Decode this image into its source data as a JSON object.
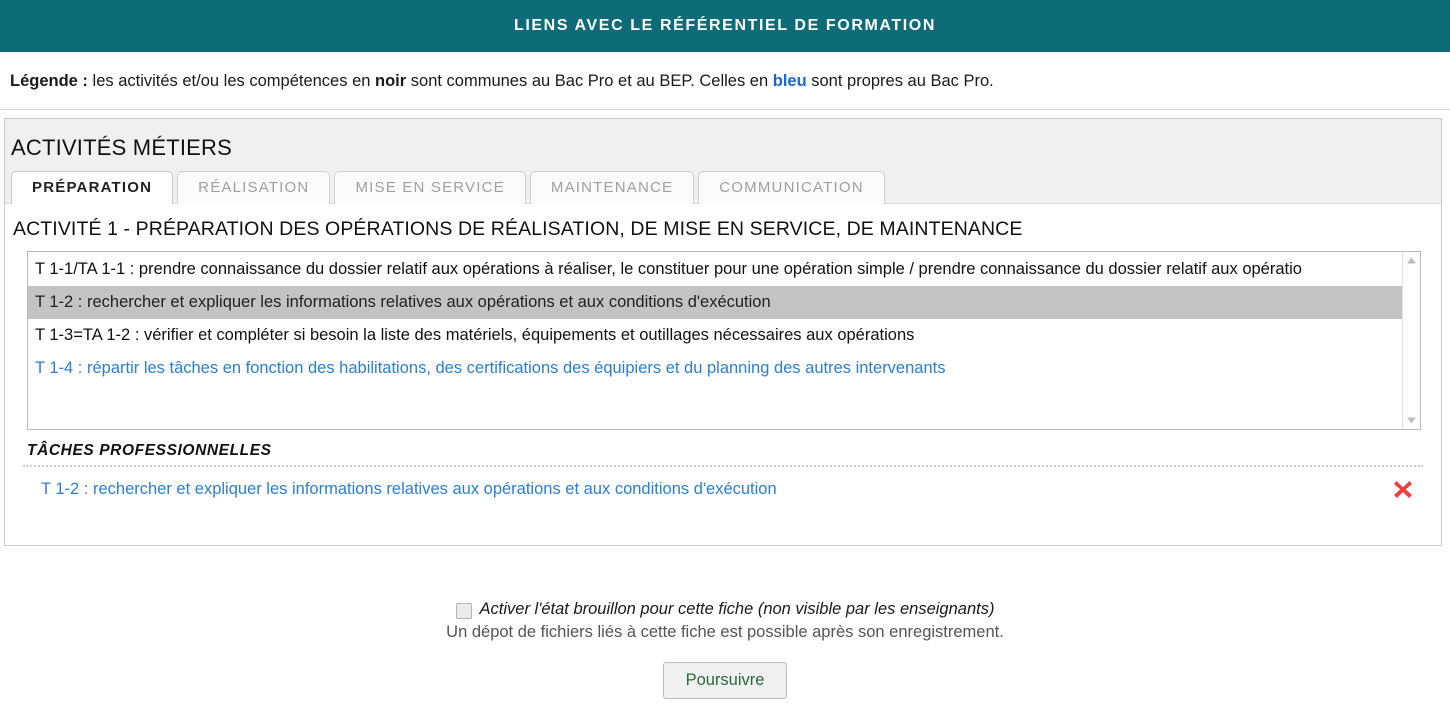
{
  "header": {
    "title": "LIENS AVEC LE RÉFÉRENTIEL DE FORMATION",
    "bg_color": "#0d6c77",
    "text_color": "#ffffff"
  },
  "legend": {
    "label": "Légende :",
    "part1": " les activités et/ou les compétences en ",
    "bold_word": "noir",
    "part2": " sont communes au Bac Pro et au BEP. Celles en ",
    "blue_word": "bleu",
    "part3": " sont propres au Bac Pro.",
    "blue_color": "#1868d8"
  },
  "section": {
    "title": "ACTIVITÉS MÉTIERS"
  },
  "tabs": [
    {
      "label": "PRÉPARATION",
      "active": true
    },
    {
      "label": "RÉALISATION",
      "active": false
    },
    {
      "label": "MISE EN SERVICE",
      "active": false
    },
    {
      "label": "MAINTENANCE",
      "active": false
    },
    {
      "label": "COMMUNICATION",
      "active": false
    }
  ],
  "activity": {
    "heading": "ACTIVITÉ 1 - PRÉPARATION DES OPÉRATIONS DE RÉALISATION, DE MISE EN SERVICE, DE MAINTENANCE"
  },
  "listbox": {
    "items": [
      {
        "text": "T 1-1/TA 1-1 : prendre connaissance du dossier relatif aux opérations à réaliser, le constituer pour une opération simple / prendre connaissance du dossier relatif aux opératio",
        "style": "normal",
        "selected": false
      },
      {
        "text": "T 1-2 : rechercher et expliquer les informations relatives aux opérations et aux conditions d'exécution",
        "style": "normal",
        "selected": true
      },
      {
        "text": "T 1-3=TA 1-2 : vérifier et compléter si besoin la liste des matériels, équipements et outillages nécessaires aux opérations",
        "style": "normal",
        "selected": false
      },
      {
        "text": "T 1-4 : répartir les tâches en fonction des habilitations, des certifications des équipiers et du planning des autres intervenants",
        "style": "blue",
        "selected": false
      }
    ],
    "selected_bg": "#c3c3c3",
    "blue_color": "#2a7fd4",
    "scrollbar": {
      "up_icon": "chevron-up-icon",
      "down_icon": "chevron-down-icon"
    }
  },
  "taches": {
    "title": "TÂCHES PROFESSIONNELLES",
    "rows": [
      {
        "label": "T 1-2 : rechercher et expliquer les informations relatives aux opérations et aux conditions d'exécution",
        "delete_icon": "delete-cross-icon",
        "delete_color": "#ef3e3e"
      }
    ]
  },
  "footer": {
    "draft_checkbox_label": "Activer l'état brouillon pour cette fiche (non visible par les enseignants)",
    "draft_checked": false,
    "deposit_note": "Un dépot de fichiers liés à cette fiche est possible après son enregistrement.",
    "continue_label": "Poursuivre",
    "continue_text_color": "#2b6b38"
  }
}
